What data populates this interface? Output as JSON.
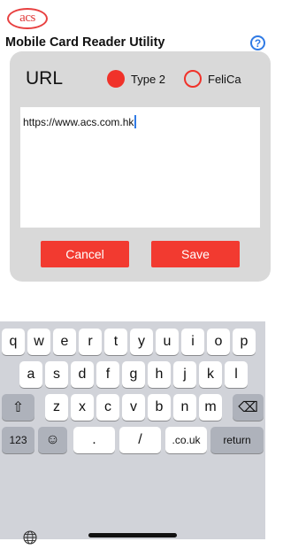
{
  "app": {
    "logo_text": "acs",
    "title": "Mobile Card Reader Utility",
    "help_icon": "?"
  },
  "dialog": {
    "title": "URL",
    "radio_type2": "Type 2",
    "radio_felica": "FeliCa",
    "url_value": "https://www.acs.com.hk",
    "cancel_label": "Cancel",
    "save_label": "Save"
  },
  "keyboard": {
    "row1": [
      "q",
      "w",
      "e",
      "r",
      "t",
      "y",
      "u",
      "i",
      "o",
      "p"
    ],
    "row2": [
      "a",
      "s",
      "d",
      "f",
      "g",
      "h",
      "j",
      "k",
      "l"
    ],
    "row3": [
      "z",
      "x",
      "c",
      "v",
      "b",
      "n",
      "m"
    ],
    "shift_icon": "⇧",
    "delete_icon": "⌫",
    "numbers_label": "123",
    "emoji_icon": "☺",
    "dot_label": ".",
    "slash_label": "/",
    "couk_label": ".co.uk",
    "return_label": "return",
    "globe_icon": "🌐"
  },
  "colors": {
    "accent": "#f23a30",
    "help_blue": "#2f7ae5",
    "dialog_bg": "#d9d9d9",
    "keyboard_bg": "#d1d3d9"
  }
}
